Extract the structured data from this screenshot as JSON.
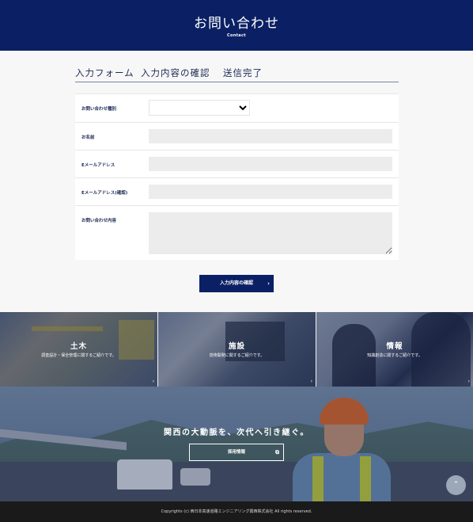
{
  "header": {
    "title": "お問い合わせ",
    "subtitle": "Contact"
  },
  "steps": [
    "入力フォーム",
    "入力内容の確認",
    "送信完了"
  ],
  "form": {
    "fields": [
      {
        "label": "お問い合わせ種別",
        "value": ""
      },
      {
        "label": "お名前",
        "value": ""
      },
      {
        "label": "Eメールアドレス",
        "value": ""
      },
      {
        "label": "Eメールアドレス(確認)",
        "value": ""
      },
      {
        "label": "お問い合わせ内容",
        "value": ""
      }
    ],
    "confirm_label": "入力内容の確認",
    "arrow": "›"
  },
  "tiles": [
    {
      "name": "土木",
      "desc": "調査設計・保全管理に関するご紹介です。"
    },
    {
      "name": "施設",
      "desc": "技術開発に関するご紹介です。"
    },
    {
      "name": "情報",
      "desc": "知識創造に関するご紹介です。"
    }
  ],
  "banner": {
    "slogan": "関西の大動脈を、次代へ引き継ぐ。",
    "recruit_label": "採用情報",
    "external_icon": "⧉"
  },
  "to_top_icon": "⌃",
  "footer": {
    "copyright": "Copyrights (c) 西日本高速道路エンジニアリング関西株式会社 All rights reserved."
  }
}
